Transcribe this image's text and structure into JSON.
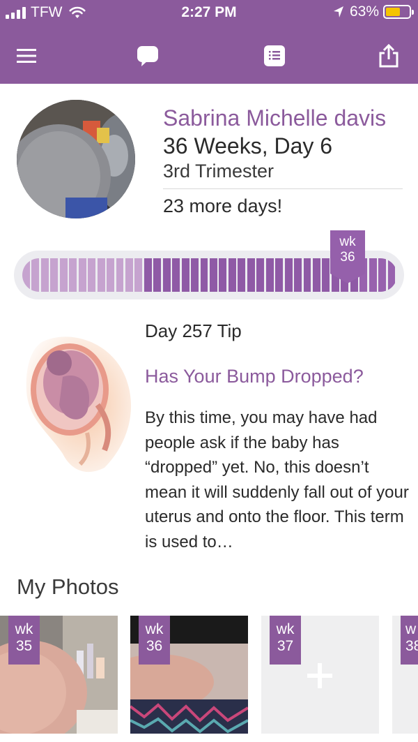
{
  "status_bar": {
    "carrier": "TFW",
    "time": "2:27 PM",
    "battery_percent": "63%",
    "battery_level": 0.63
  },
  "nav": {
    "icons": [
      "menu-icon",
      "chat-icon",
      "notes-icon",
      "share-icon"
    ]
  },
  "profile": {
    "name": "Sabrina Michelle davis",
    "weeks_days": "36 Weeks, Day 6",
    "trimester": "3rd Trimester",
    "countdown": "23 more days!"
  },
  "progress": {
    "marker_line1": "wk",
    "marker_line2": "36",
    "current_week": 36,
    "total_weeks": 40
  },
  "tip": {
    "day_label": "Day 257 Tip",
    "title": "Has Your Bump Dropped?",
    "body": "By this time, you may have had people ask if the baby has “dropped” yet. No, this doesn’t mean it will suddenly fall out of your uterus and onto the floor. This term is used to…"
  },
  "photos": {
    "heading": "My Photos",
    "items": [
      {
        "wk": "wk",
        "num": "35"
      },
      {
        "wk": "wk",
        "num": "36"
      },
      {
        "wk": "wk",
        "num": "37"
      },
      {
        "wk": "w",
        "num": "38"
      }
    ]
  },
  "colors": {
    "brand_purple": "#8b5a9c",
    "progress_light": "#c6a3cf",
    "progress_mid": "#8f5aa6",
    "progress_dark": "#9862ae",
    "battery": "#f5c400"
  }
}
